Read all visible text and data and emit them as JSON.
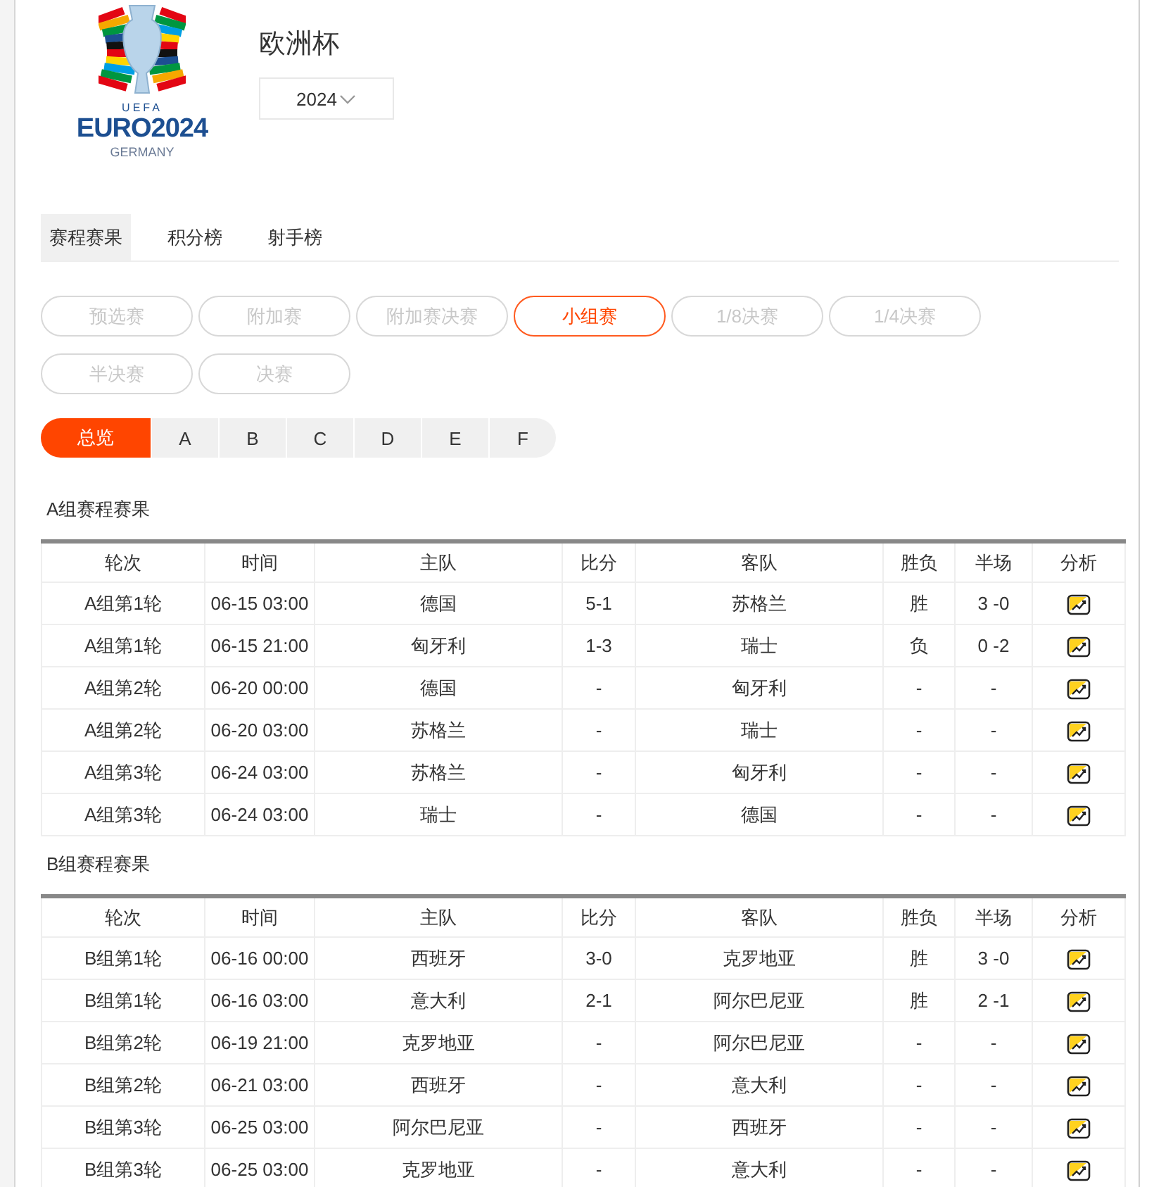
{
  "logo": {
    "org": "UEFA",
    "name": "EURO2024",
    "host": "GERMANY"
  },
  "title": "欧洲杯",
  "season": {
    "value": "2024"
  },
  "tabs": [
    {
      "label": "赛程赛果",
      "selected": true
    },
    {
      "label": "积分榜",
      "selected": false
    },
    {
      "label": "射手榜",
      "selected": false
    }
  ],
  "stages": [
    {
      "label": "预选赛",
      "selected": false
    },
    {
      "label": "附加赛",
      "selected": false
    },
    {
      "label": "附加赛决赛",
      "selected": false
    },
    {
      "label": "小组赛",
      "selected": true
    },
    {
      "label": "1/8决赛",
      "selected": false
    },
    {
      "label": "1/4决赛",
      "selected": false
    },
    {
      "label": "半决赛",
      "selected": false
    },
    {
      "label": "决赛",
      "selected": false
    }
  ],
  "groups": [
    {
      "label": "总览",
      "selected": true
    },
    {
      "label": "A",
      "selected": false
    },
    {
      "label": "B",
      "selected": false
    },
    {
      "label": "C",
      "selected": false
    },
    {
      "label": "D",
      "selected": false
    },
    {
      "label": "E",
      "selected": false
    },
    {
      "label": "F",
      "selected": false
    }
  ],
  "sections": [
    {
      "title": "A组赛程赛果",
      "columns": [
        "轮次",
        "时间",
        "主队",
        "比分",
        "客队",
        "胜负",
        "半场",
        "分析"
      ],
      "rows": [
        [
          "A组第1轮",
          "06-15 03:00",
          "德国",
          "5-1",
          "苏格兰",
          "胜",
          "3 -0"
        ],
        [
          "A组第1轮",
          "06-15 21:00",
          "匈牙利",
          "1-3",
          "瑞士",
          "负",
          "0 -2"
        ],
        [
          "A组第2轮",
          "06-20 00:00",
          "德国",
          "-",
          "匈牙利",
          "-",
          "-"
        ],
        [
          "A组第2轮",
          "06-20 03:00",
          "苏格兰",
          "-",
          "瑞士",
          "-",
          "-"
        ],
        [
          "A组第3轮",
          "06-24 03:00",
          "苏格兰",
          "-",
          "匈牙利",
          "-",
          "-"
        ],
        [
          "A组第3轮",
          "06-24 03:00",
          "瑞士",
          "-",
          "德国",
          "-",
          "-"
        ]
      ]
    },
    {
      "title": "B组赛程赛果",
      "columns": [
        "轮次",
        "时间",
        "主队",
        "比分",
        "客队",
        "胜负",
        "半场",
        "分析"
      ],
      "rows": [
        [
          "B组第1轮",
          "06-16 00:00",
          "西班牙",
          "3-0",
          "克罗地亚",
          "胜",
          "3 -0"
        ],
        [
          "B组第1轮",
          "06-16 03:00",
          "意大利",
          "2-1",
          "阿尔巴尼亚",
          "胜",
          "2 -1"
        ],
        [
          "B组第2轮",
          "06-19 21:00",
          "克罗地亚",
          "-",
          "阿尔巴尼亚",
          "-",
          "-"
        ],
        [
          "B组第2轮",
          "06-21 03:00",
          "西班牙",
          "-",
          "意大利",
          "-",
          "-"
        ],
        [
          "B组第3轮",
          "06-25 03:00",
          "阿尔巴尼亚",
          "-",
          "西班牙",
          "-",
          "-"
        ],
        [
          "B组第3轮",
          "06-25 03:00",
          "克罗地亚",
          "-",
          "意大利",
          "-",
          "-"
        ]
      ]
    }
  ]
}
